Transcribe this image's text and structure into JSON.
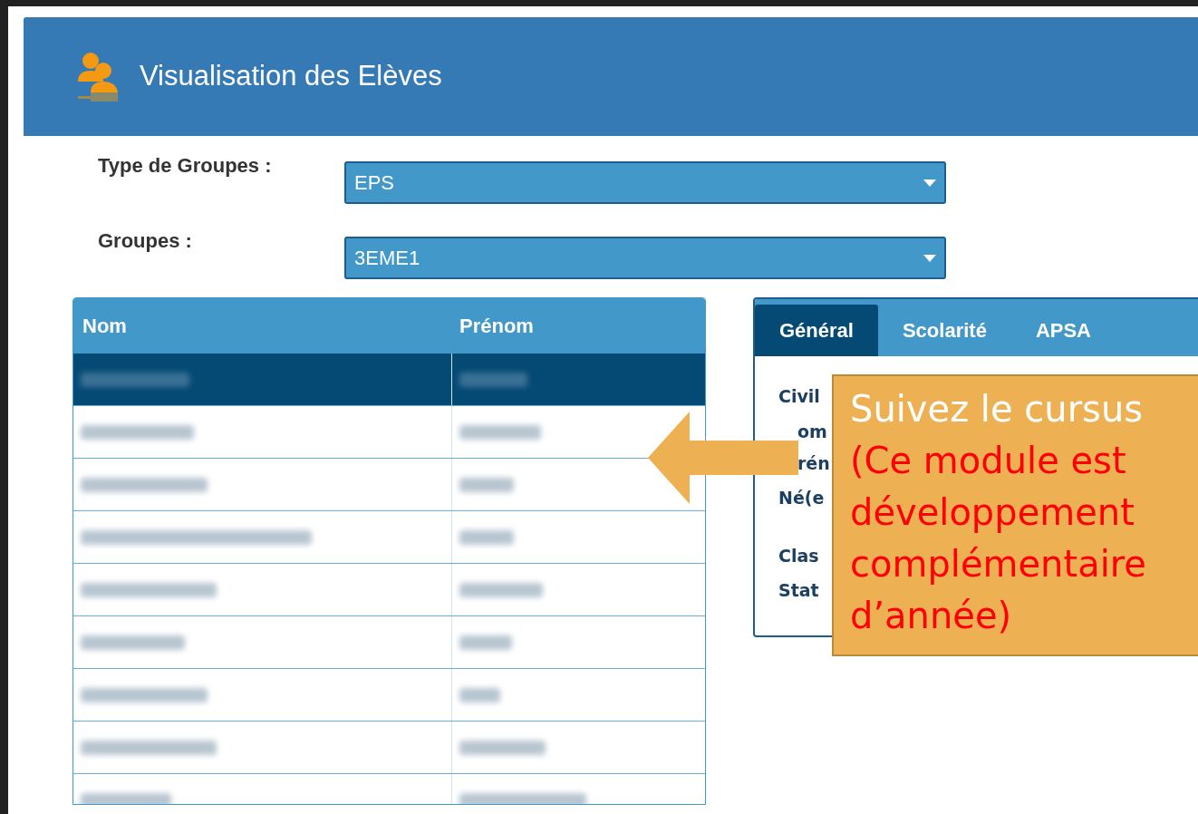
{
  "header": {
    "title": "Visualisation des Elèves"
  },
  "filters": [
    {
      "label": "Type de Groupes :",
      "value": "EPS"
    },
    {
      "label": "Groupes :",
      "value": "3EME1"
    }
  ],
  "table": {
    "columns": [
      "Nom",
      "Prénom"
    ],
    "rows": [
      {
        "selected": true
      },
      {
        "selected": false
      },
      {
        "selected": false
      },
      {
        "selected": false
      },
      {
        "selected": false
      },
      {
        "selected": false
      },
      {
        "selected": false
      },
      {
        "selected": false
      },
      {
        "selected": false
      }
    ]
  },
  "detail": {
    "tabs": [
      {
        "label": "Général",
        "selected": true
      },
      {
        "label": "Scolarité",
        "selected": false
      },
      {
        "label": "APSA",
        "selected": false
      }
    ],
    "labels": [
      "Civil",
      "om",
      "rén",
      "Né(e",
      "Clas",
      "Stat"
    ]
  },
  "callout": {
    "title": "Suivez le cursus",
    "note_lines": [
      "(Ce module est",
      "développement",
      "complémentaire",
      "d’année)"
    ]
  }
}
